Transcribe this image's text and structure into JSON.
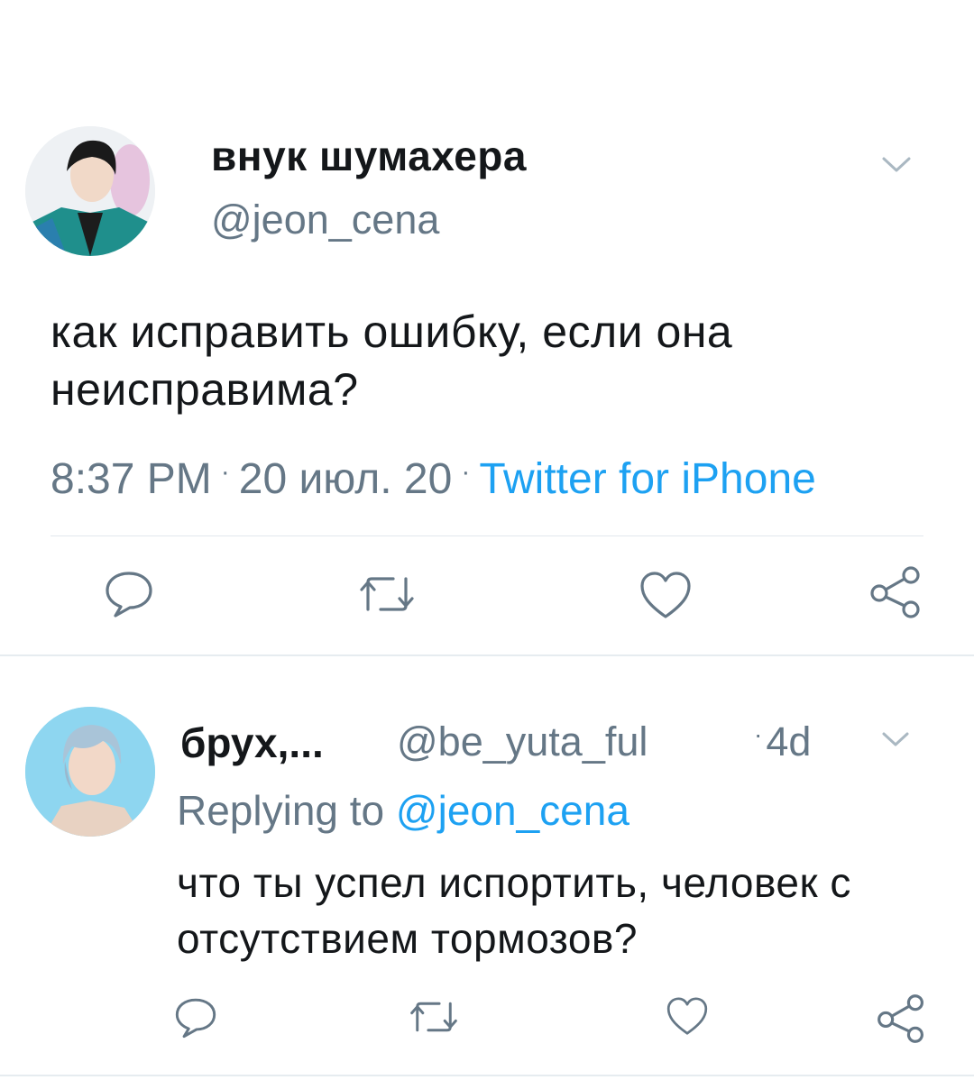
{
  "main_tweet": {
    "display_name": "внук шумахера",
    "handle": "@jeon_cena",
    "text": "как исправить ошибку, если она неисправима?",
    "time": "8:37 PM",
    "date": "20 июл. 20",
    "source": "Twitter for iPhone",
    "separator": "·"
  },
  "reply_tweet": {
    "display_name": "брух,...",
    "handle": "@be_yuta_ful",
    "age": "4d",
    "age_dot": "·",
    "replying_to_label": "Replying to",
    "replying_to_handle": "@jeon_cena",
    "text": "что ты успел испортить, человек с отсутствием тормозов?"
  },
  "icons": {
    "reply": "reply-bubble-icon",
    "retweet": "retweet-icon",
    "like": "heart-icon",
    "share": "share-icon",
    "more": "chevron-down-icon"
  },
  "colors": {
    "accent": "#1da1f2",
    "secondary_text": "#657786",
    "primary_text": "#14171a",
    "divider": "#e1e8ed",
    "icon": "#657786"
  }
}
